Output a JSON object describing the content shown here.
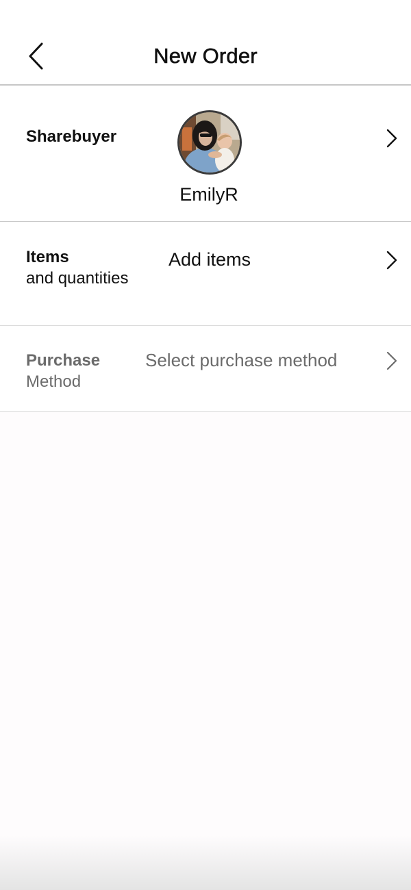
{
  "header": {
    "title": "New Order",
    "back_icon": "chevron-left-icon"
  },
  "sharebuyer": {
    "label": "Sharebuyer",
    "username": "EmilyR",
    "avatar": "user-avatar-photo",
    "chevron_icon": "chevron-right-icon"
  },
  "items": {
    "label": "Items",
    "sublabel": "and quantities",
    "value": "Add items",
    "chevron_icon": "chevron-right-icon"
  },
  "purchase_method": {
    "label": "Purchase",
    "sublabel": "Method",
    "value": "Select purchase method",
    "chevron_icon": "chevron-right-icon",
    "state": "disabled"
  },
  "colors": {
    "text": "#111111",
    "muted_text": "#6b6b6b",
    "divider": "#c6c6c6",
    "background": "#fefcfd"
  }
}
